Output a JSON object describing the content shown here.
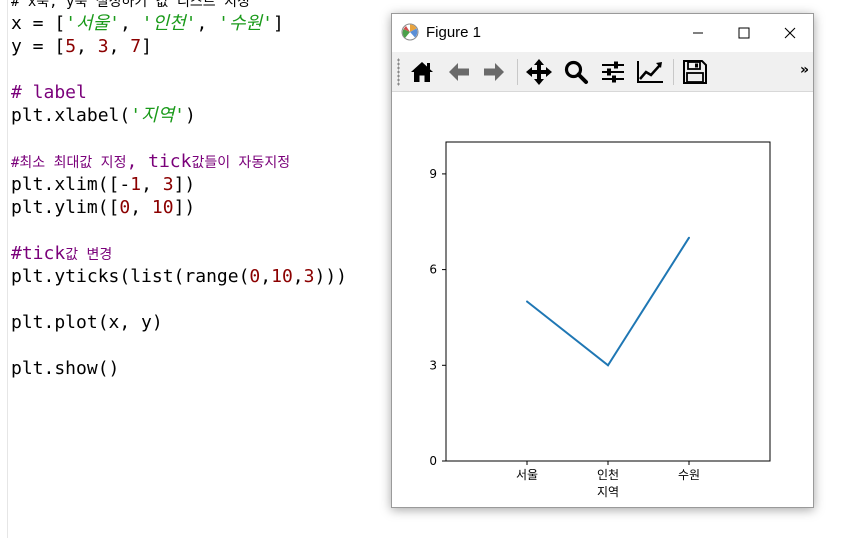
{
  "editor": {
    "lines": [
      {
        "parts": [
          {
            "t": "# x축, y축 설정하기 값 리스트 지정",
            "c": "cmt-small"
          }
        ]
      },
      {
        "parts": [
          {
            "t": "x = ["
          },
          {
            "t": "'서울'",
            "c": "str"
          },
          {
            "t": ", "
          },
          {
            "t": "'인천'",
            "c": "str"
          },
          {
            "t": ", "
          },
          {
            "t": "'수원'",
            "c": "str"
          },
          {
            "t": "]"
          }
        ]
      },
      {
        "parts": [
          {
            "t": "y = ["
          },
          {
            "t": "5",
            "c": "num"
          },
          {
            "t": ", "
          },
          {
            "t": "3",
            "c": "num"
          },
          {
            "t": ", "
          },
          {
            "t": "7",
            "c": "num"
          },
          {
            "t": "]"
          }
        ]
      },
      {
        "parts": [
          {
            "t": ""
          }
        ]
      },
      {
        "parts": [
          {
            "t": "# label",
            "c": "cmt"
          }
        ]
      },
      {
        "parts": [
          {
            "t": "plt.xlabel("
          },
          {
            "t": "'지역'",
            "c": "str"
          },
          {
            "t": ")"
          }
        ]
      },
      {
        "parts": [
          {
            "t": ""
          }
        ]
      },
      {
        "parts": [
          {
            "t": "#최소 최대값 지정",
            "c": "cmt cmt-small"
          },
          {
            "t": ", tick",
            "c": "cmt"
          },
          {
            "t": "값들이 자동지정",
            "c": "cmt cmt-small"
          }
        ]
      },
      {
        "parts": [
          {
            "t": "plt.xlim([-"
          },
          {
            "t": "1",
            "c": "num"
          },
          {
            "t": ", "
          },
          {
            "t": "3",
            "c": "num"
          },
          {
            "t": "])"
          }
        ]
      },
      {
        "parts": [
          {
            "t": "plt.ylim(["
          },
          {
            "t": "0",
            "c": "num"
          },
          {
            "t": ", "
          },
          {
            "t": "10",
            "c": "num"
          },
          {
            "t": "])"
          }
        ]
      },
      {
        "parts": [
          {
            "t": ""
          }
        ]
      },
      {
        "parts": [
          {
            "t": "#tick",
            "c": "cmt"
          },
          {
            "t": "값 변경",
            "c": "cmt cmt-small"
          }
        ]
      },
      {
        "parts": [
          {
            "t": "plt.yticks(list(range("
          },
          {
            "t": "0",
            "c": "num"
          },
          {
            "t": ","
          },
          {
            "t": "10",
            "c": "num"
          },
          {
            "t": ","
          },
          {
            "t": "3",
            "c": "num"
          },
          {
            "t": ")))"
          }
        ]
      },
      {
        "parts": [
          {
            "t": ""
          }
        ]
      },
      {
        "parts": [
          {
            "t": "plt.plot(x, y)"
          }
        ]
      },
      {
        "parts": [
          {
            "t": ""
          }
        ]
      },
      {
        "parts": [
          {
            "t": "plt.show()"
          }
        ]
      }
    ]
  },
  "figure_window": {
    "title": "Figure 1",
    "buttons": {
      "minimize": "—",
      "maximize": "☐",
      "close": "✕"
    },
    "toolbar_icons": [
      "home-icon",
      "back-arrow-icon",
      "forward-arrow-icon",
      "pan-icon",
      "zoom-icon",
      "configure-subplots-icon",
      "edit-axis-icon",
      "save-icon"
    ],
    "more_label": "»"
  },
  "chart_data": {
    "type": "line",
    "categories": [
      "서울",
      "인천",
      "수원"
    ],
    "x": [
      0,
      1,
      2
    ],
    "values": [
      5,
      3,
      7
    ],
    "xlabel": "지역",
    "ylabel": "",
    "title": "",
    "xlim": [
      -1,
      3
    ],
    "ylim": [
      0,
      10
    ],
    "yticks": [
      0,
      3,
      6,
      9
    ],
    "line_color": "#1f77b4",
    "grid": false
  }
}
